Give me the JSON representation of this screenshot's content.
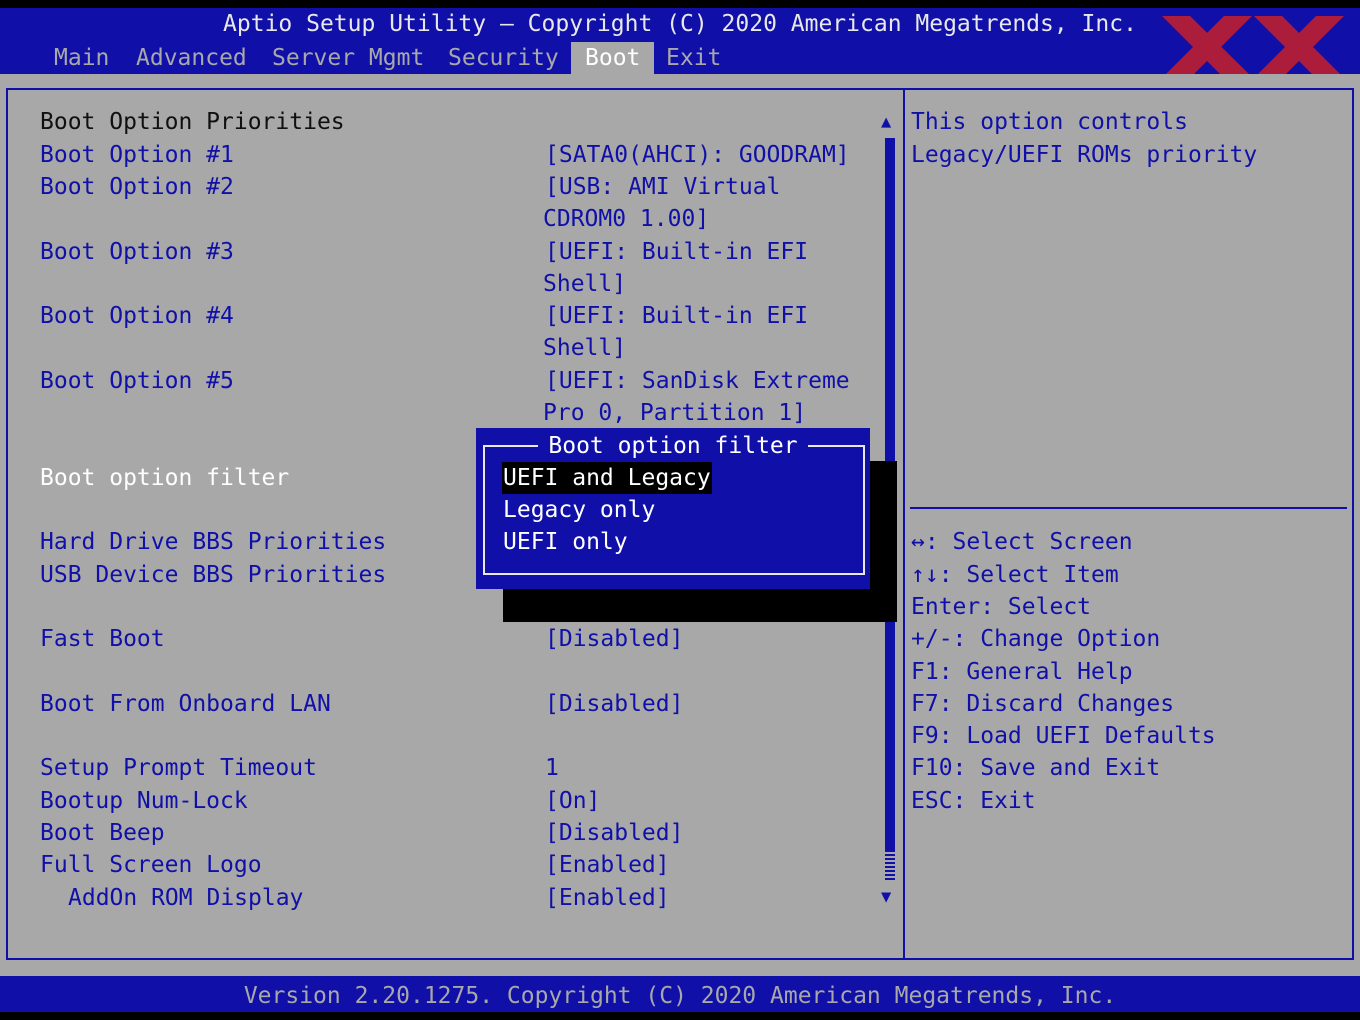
{
  "header": {
    "title": "Aptio Setup Utility – Copyright (C) 2020 American Megatrends, Inc.",
    "tabs": [
      {
        "label": "Main"
      },
      {
        "label": "Advanced"
      },
      {
        "label": "Server Mgmt"
      },
      {
        "label": "Security"
      },
      {
        "label": "Boot"
      },
      {
        "label": "Exit"
      }
    ],
    "active_tab": "Boot"
  },
  "settings": {
    "section_title": "Boot Option Priorities",
    "boot_option_1": {
      "label": "Boot Option #1",
      "value": "[SATA0(AHCI): GOODRAM]"
    },
    "boot_option_2": {
      "label": "Boot Option #2",
      "value_line1": "[USB: AMI Virtual",
      "value_line2": "CDROM0 1.00]"
    },
    "boot_option_3": {
      "label": "Boot Option #3",
      "value_line1": "[UEFI: Built-in EFI",
      "value_line2": "Shell]"
    },
    "boot_option_4": {
      "label": "Boot Option #4",
      "value_line1": "[UEFI: Built-in EFI",
      "value_line2": "Shell]"
    },
    "boot_option_5": {
      "label": "Boot Option #5",
      "value_line1": "[UEFI: SanDisk Extreme",
      "value_line2": "Pro 0, Partition 1]"
    },
    "boot_option_filter": {
      "label": "Boot option filter"
    },
    "hdd_bbs": {
      "label": "Hard Drive BBS Priorities"
    },
    "usb_bbs": {
      "label": "USB Device BBS Priorities"
    },
    "fast_boot": {
      "label": "Fast Boot",
      "value": "[Disabled]"
    },
    "onboard_lan": {
      "label": "Boot From Onboard LAN",
      "value": "[Disabled]"
    },
    "prompt_timeout": {
      "label": "Setup Prompt Timeout",
      "value": "1"
    },
    "numlock": {
      "label": "Bootup Num-Lock",
      "value": "[On]"
    },
    "beep": {
      "label": "Boot Beep",
      "value": "[Disabled]"
    },
    "fs_logo": {
      "label": "Full Screen Logo",
      "value": "[Enabled]"
    },
    "addon_rom": {
      "label": "AddOn ROM Display",
      "value": "[Enabled]"
    }
  },
  "popup": {
    "title": "Boot option filter",
    "options": [
      {
        "label": "UEFI and Legacy",
        "selected": true
      },
      {
        "label": "Legacy only",
        "selected": false
      },
      {
        "label": "UEFI only",
        "selected": false
      }
    ]
  },
  "help": {
    "description_line1": "This option controls",
    "description_line2": "Legacy/UEFI ROMs priority",
    "keys": [
      "↔: Select Screen",
      "↑↓: Select Item",
      "Enter: Select",
      "+/-: Change Option",
      "F1: General Help",
      "F7: Discard Changes",
      "F9: Load UEFI Defaults",
      "F10: Save and Exit",
      "ESC: Exit"
    ]
  },
  "scrollbar": {
    "up_arrow": "▲",
    "down_arrow": "▼"
  },
  "footer": {
    "text": "Version 2.20.1275. Copyright (C) 2020 American Megatrends, Inc."
  },
  "colors": {
    "bios_blue": "#1010a8",
    "bios_gray": "#a8a8a8",
    "highlight": "#ffffff",
    "watermark_red": "#c8202a"
  }
}
